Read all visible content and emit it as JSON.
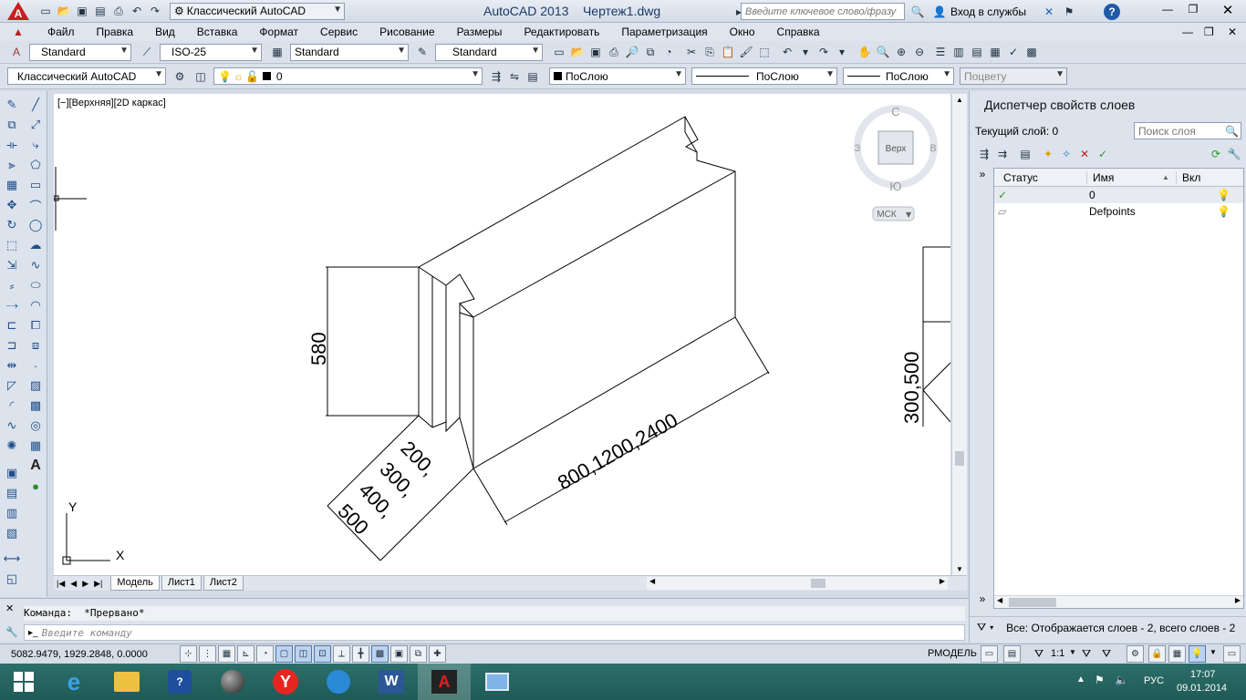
{
  "titlebar": {
    "workspace": "Классический AutoCAD",
    "title": "AutoCAD 2013    Чертеж1.dwg",
    "search_placeholder": "Введите ключевое слово/фразу",
    "signin": "Вход в службы",
    "help": "?"
  },
  "menu": [
    "Файл",
    "Правка",
    "Вид",
    "Вставка",
    "Формат",
    "Сервис",
    "Рисование",
    "Размеры",
    "Редактировать",
    "Параметризация",
    "Окно",
    "Справка"
  ],
  "styles": {
    "text_style": "Standard",
    "dim_style": "ISO-25",
    "table_style": "Standard",
    "mleader_style": "Standard"
  },
  "layers_bar": {
    "workspace": "Классический AutoCAD",
    "layer": "0",
    "color": "ПоСлою",
    "linetype": "ПоСлою",
    "lineweight": "ПоСлою",
    "plotstyle": "Поцвету"
  },
  "viewport": {
    "label": "[−][Верхняя][2D каркас]",
    "viewcube": {
      "north": "С",
      "south": "Ю",
      "west": "З",
      "east": "В",
      "face": "Верх",
      "ucs": "МСК"
    },
    "dims": {
      "height": "580",
      "length": "800,1200,2400",
      "width1": "200,",
      "width2": "300,",
      "width3": "400,",
      "width4": "500",
      "right_dim": "300,500"
    },
    "ucs_x": "X",
    "ucs_y": "Y"
  },
  "tabs": [
    "Модель",
    "Лист1",
    "Лист2"
  ],
  "command": {
    "history": "Команда:  *Прервано*",
    "placeholder": "Введите команду"
  },
  "status": {
    "coords": "5082.9479, 1929.2848, 0.0000",
    "model": "РМОДЕЛЬ",
    "scale": "1:1"
  },
  "palette": {
    "title": "Диспетчер свойств слоев",
    "current_layer": "Текущий слой: 0",
    "search_placeholder": "Поиск слоя",
    "columns": [
      "Статус",
      "Имя",
      "Вкл"
    ],
    "layers": [
      {
        "name": "0",
        "current": true
      },
      {
        "name": "Defpoints",
        "current": false
      }
    ],
    "footer": "Все: Отображается слоев - 2, всего слоев - 2"
  },
  "taskbar": {
    "lang": "РУС",
    "time": "17:07",
    "date": "09.01.2014"
  }
}
